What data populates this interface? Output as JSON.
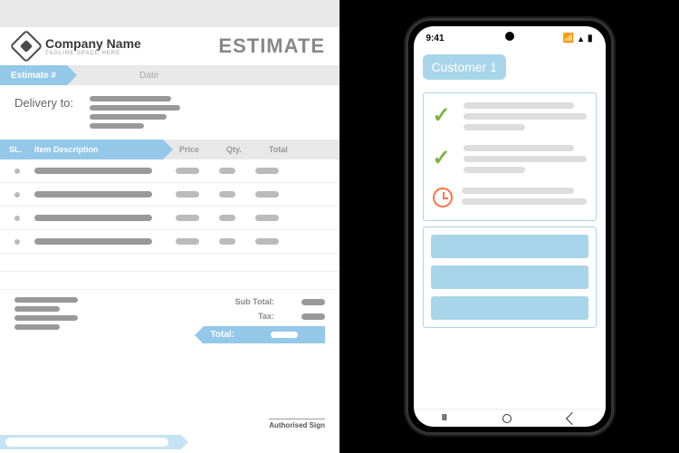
{
  "doc": {
    "company_name": "Company Name",
    "tagline": "TAGLINE SPACE HERE",
    "title": "ESTIMATE",
    "estimate_no_label": "Estimate #",
    "date_label": "Date",
    "delivery_label": "Delivery to:",
    "columns": {
      "sl": "SL.",
      "desc": "Item Description",
      "price": "Price",
      "qty": "Qty.",
      "total": "Total"
    },
    "subtotal_label": "Sub Total:",
    "tax_label": "Tax:",
    "total_label": "Total:",
    "sign_label": "Authorised Sign"
  },
  "phone": {
    "time": "9:41",
    "customer": "Customer 1"
  }
}
